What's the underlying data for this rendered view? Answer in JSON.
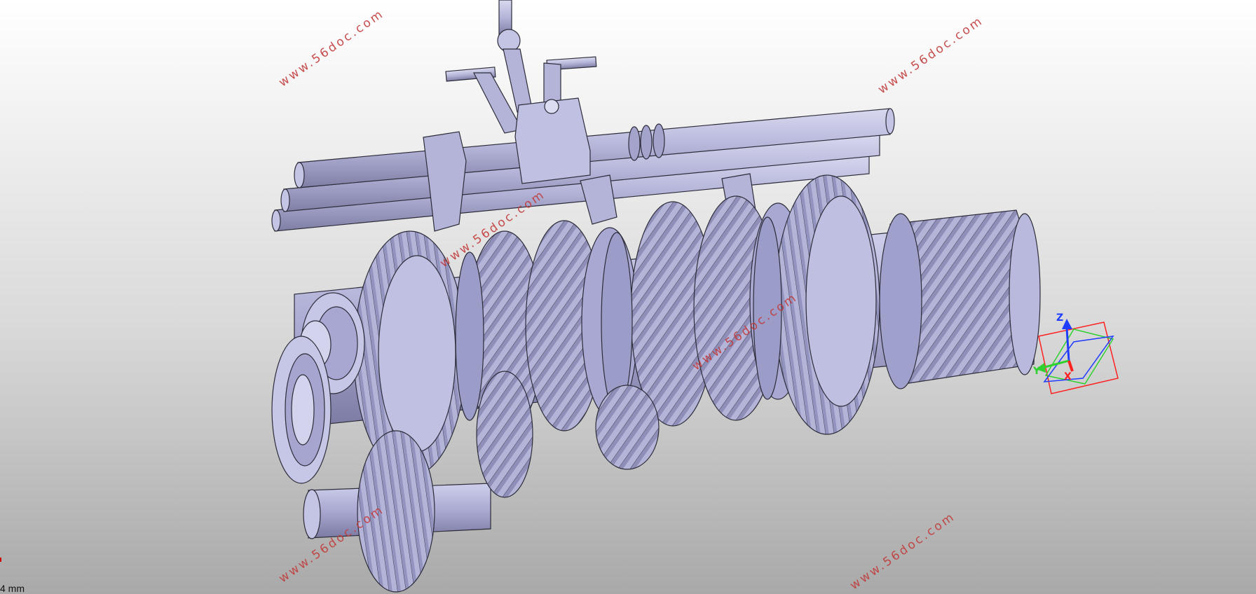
{
  "viewport": {
    "background_top": "#ffffff",
    "background_bottom": "#a9a9a9",
    "part_color": "#b4b4d9",
    "part_shade": "#8e8eb8",
    "edge_color": "#2c2c3a"
  },
  "watermarks": [
    "www.56doc.com",
    "www.56doc.com",
    "www.56doc.com",
    "www.56doc.com",
    "www.56doc.com",
    "www.56doc.com"
  ],
  "triad": {
    "z_label": "Z",
    "y_label": "Y",
    "x_label": "X",
    "z_color": "#1f3cff",
    "y_color": "#2fd12f",
    "x_color": "#ff2020"
  },
  "scale": {
    "label": "4 mm"
  },
  "model": {
    "name": "gearbox-assembly-icon"
  }
}
